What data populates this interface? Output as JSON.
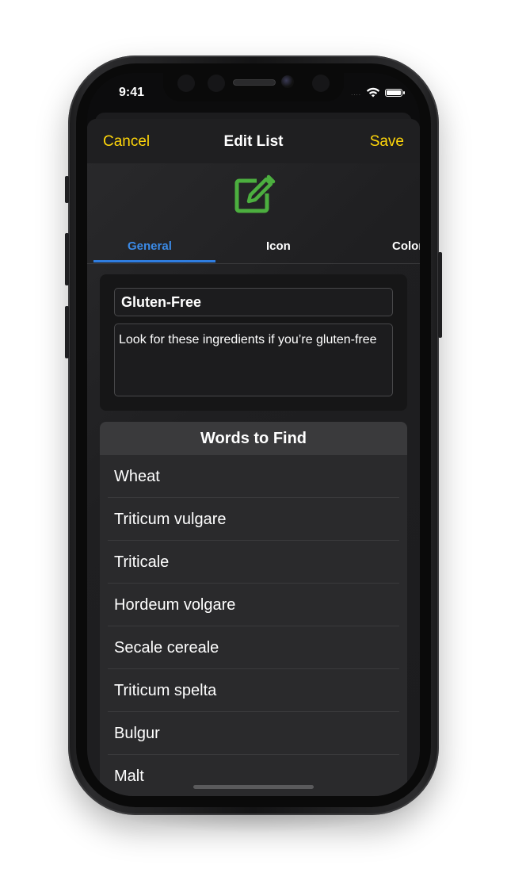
{
  "status_bar": {
    "time": "9:41",
    "signal_dots": "....",
    "wifi_icon": "wifi-icon",
    "battery_icon": "battery-icon",
    "battery_level": 1.0
  },
  "nav": {
    "cancel_label": "Cancel",
    "title": "Edit List",
    "save_label": "Save",
    "accent_color": "#ffd60a"
  },
  "header_icon": {
    "name": "edit-pencil-icon",
    "color": "#4caf3f"
  },
  "tabs": [
    {
      "label": "General",
      "active": true
    },
    {
      "label": "Icon",
      "active": false
    },
    {
      "label": "Color",
      "active": false
    }
  ],
  "tab_accent_color": "#2f7de0",
  "form": {
    "name_value": "Gluten-Free",
    "description_value": "Look for these ingredients if you’re gluten-free"
  },
  "words": {
    "header": "Words to Find",
    "items": [
      "Wheat",
      "Triticum vulgare",
      "Triticale",
      "Hordeum volgare",
      "Secale cereale",
      "Triticum spelta",
      "Bulgur",
      "Malt"
    ]
  }
}
